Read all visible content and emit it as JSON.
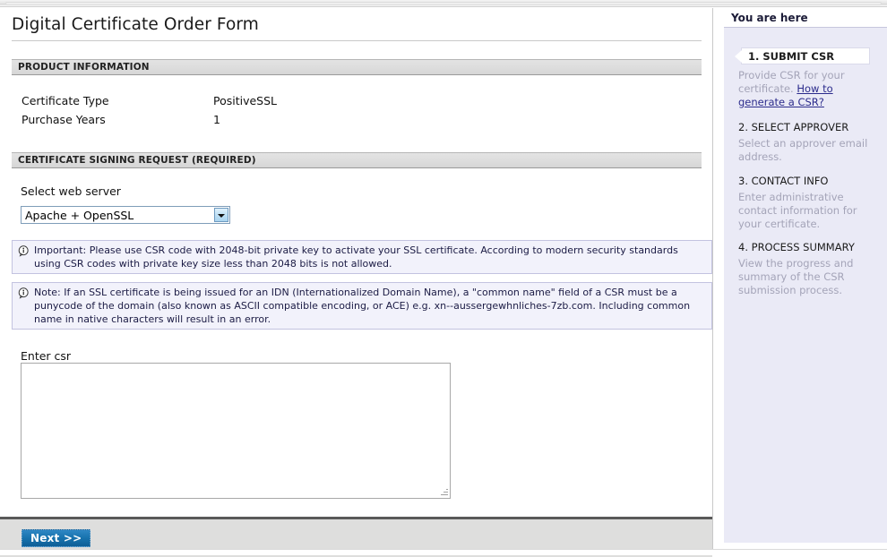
{
  "page": {
    "title": "Digital Certificate Order Form"
  },
  "product_section": {
    "header": "PRODUCT INFORMATION",
    "rows": [
      {
        "label": "Certificate Type",
        "value": "PositiveSSL"
      },
      {
        "label": "Purchase Years",
        "value": "1"
      }
    ]
  },
  "csr_section": {
    "header": "CERTIFICATE SIGNING REQUEST (REQUIRED)",
    "server_label": "Select web server",
    "server_selected": "Apache + OpenSSL",
    "notices": [
      {
        "icon": "info-icon",
        "text": "Important: Please use CSR code with 2048-bit private key to activate your SSL certificate. According to modern security standards using CSR codes with private key size less than 2048 bits is not allowed."
      },
      {
        "icon": "info-icon",
        "text": "Note: If an SSL certificate is being issued for an IDN (Internationalized Domain Name), a \"common name\" field of a CSR must be a punycode of the domain (also known as ASCII compatible encoding, or ACE) e.g. xn--aussergewhnliches-7zb.com. Including common name in native characters will result in an error."
      }
    ],
    "csr_label": "Enter csr",
    "csr_value": "",
    "csr_placeholder": ""
  },
  "footer": {
    "next_label": "Next >>"
  },
  "sidebar": {
    "header": "You are here",
    "steps": [
      {
        "title": "1. SUBMIT CSR",
        "active": true,
        "desc_before": "Provide CSR for your certificate. ",
        "link": "How to generate a CSR?",
        "desc_after": ""
      },
      {
        "title": "2. SELECT APPROVER",
        "active": false,
        "desc_before": "Select an approver email address.",
        "link": "",
        "desc_after": ""
      },
      {
        "title": "3. CONTACT INFO",
        "active": false,
        "desc_before": "Enter administrative contact information for your certificate.",
        "link": "",
        "desc_after": ""
      },
      {
        "title": "4. PROCESS SUMMARY",
        "active": false,
        "desc_before": "View the progress and summary of the CSR submission process.",
        "link": "",
        "desc_after": ""
      }
    ]
  },
  "colors": {
    "notice_bg": "#f2f2fb",
    "notice_border": "#c3c3e0",
    "sidebar_bg": "#eaeaf6",
    "button_blue": "#1873ae",
    "link_blue": "#2b2b8c",
    "section_bar": "#dcdcdc"
  }
}
